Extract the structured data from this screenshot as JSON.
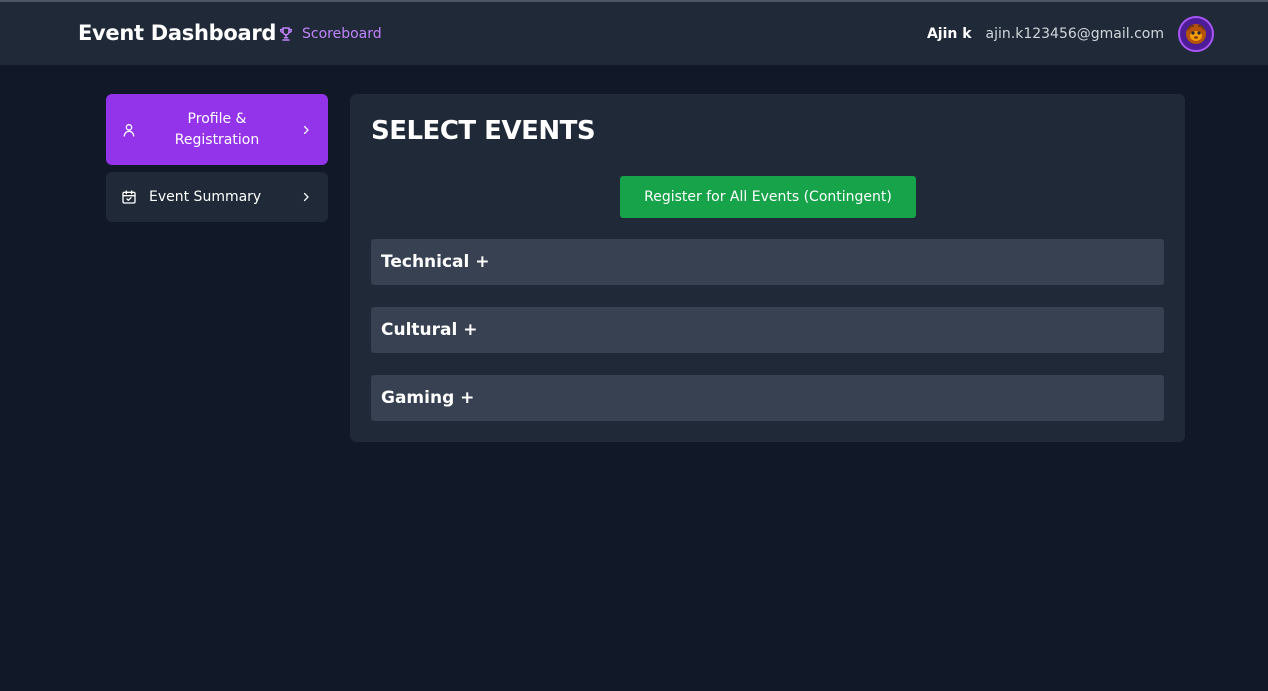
{
  "header": {
    "title": "Event Dashboard",
    "scoreboard_label": "Scoreboard",
    "scoreboard_icon": "trophy-icon",
    "user_name": "Ajin k",
    "user_email": "ajin.k123456@gmail.com",
    "avatar_icon": "avatar-icon"
  },
  "sidebar": {
    "items": [
      {
        "label": "Profile & Registration",
        "icon": "user-icon",
        "active": true
      },
      {
        "label": "Event Summary",
        "icon": "calendar-check-icon",
        "active": false
      }
    ]
  },
  "main": {
    "title": "SELECT EVENTS",
    "register_all_label": "Register for All Events (Contingent)",
    "categories": [
      {
        "label": "Technical +"
      },
      {
        "label": "Cultural +"
      },
      {
        "label": "Gaming +"
      }
    ]
  },
  "colors": {
    "background": "#111827",
    "header": "#1f2937",
    "accent_purple": "#9333ea",
    "link_purple": "#c084fc",
    "button_green": "#16a34a",
    "panel": "#1f2937",
    "category": "#374151"
  }
}
